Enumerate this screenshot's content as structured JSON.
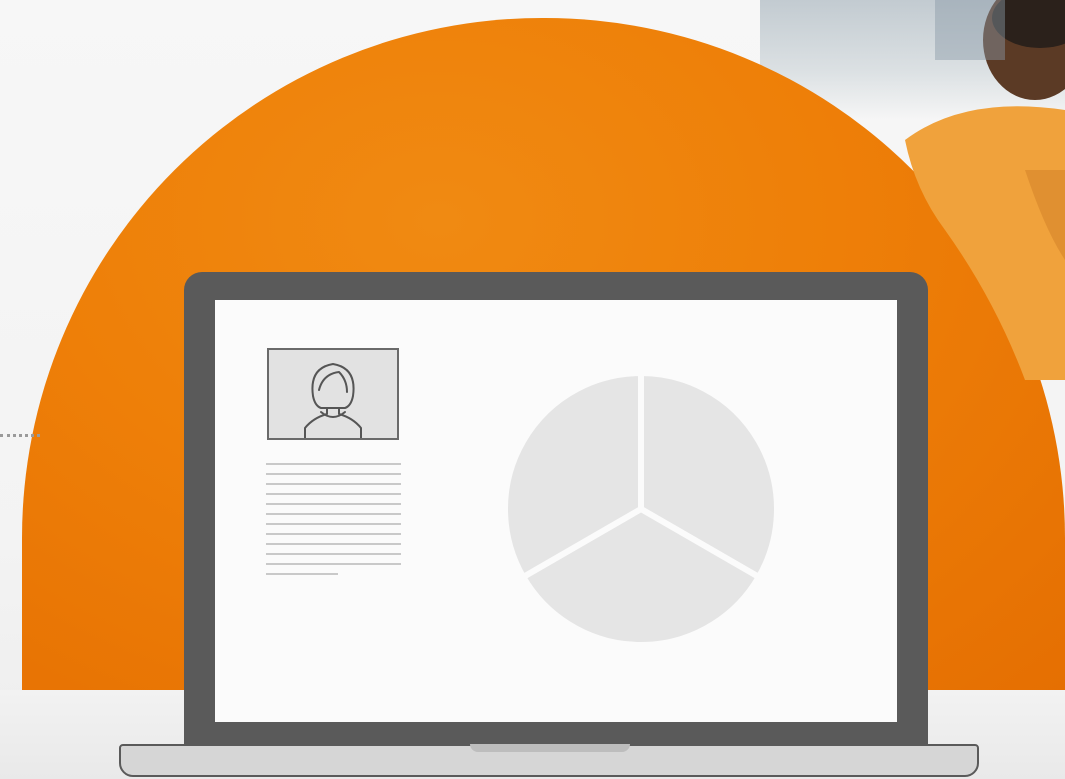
{
  "illustration": {
    "accent_color": "#ef7d07",
    "laptop_frame_color": "#5a5a5a",
    "screen_color": "#fbfbfb",
    "placeholder_color": "#e5e5e5",
    "icons": [
      "user-avatar-icon",
      "pie-chart-icon"
    ],
    "text_lines": 12
  },
  "chart_data": {
    "type": "pie",
    "values": [
      1,
      1,
      1
    ],
    "colors": [
      "#e5e5e5",
      "#e5e5e5",
      "#e5e5e5"
    ]
  }
}
